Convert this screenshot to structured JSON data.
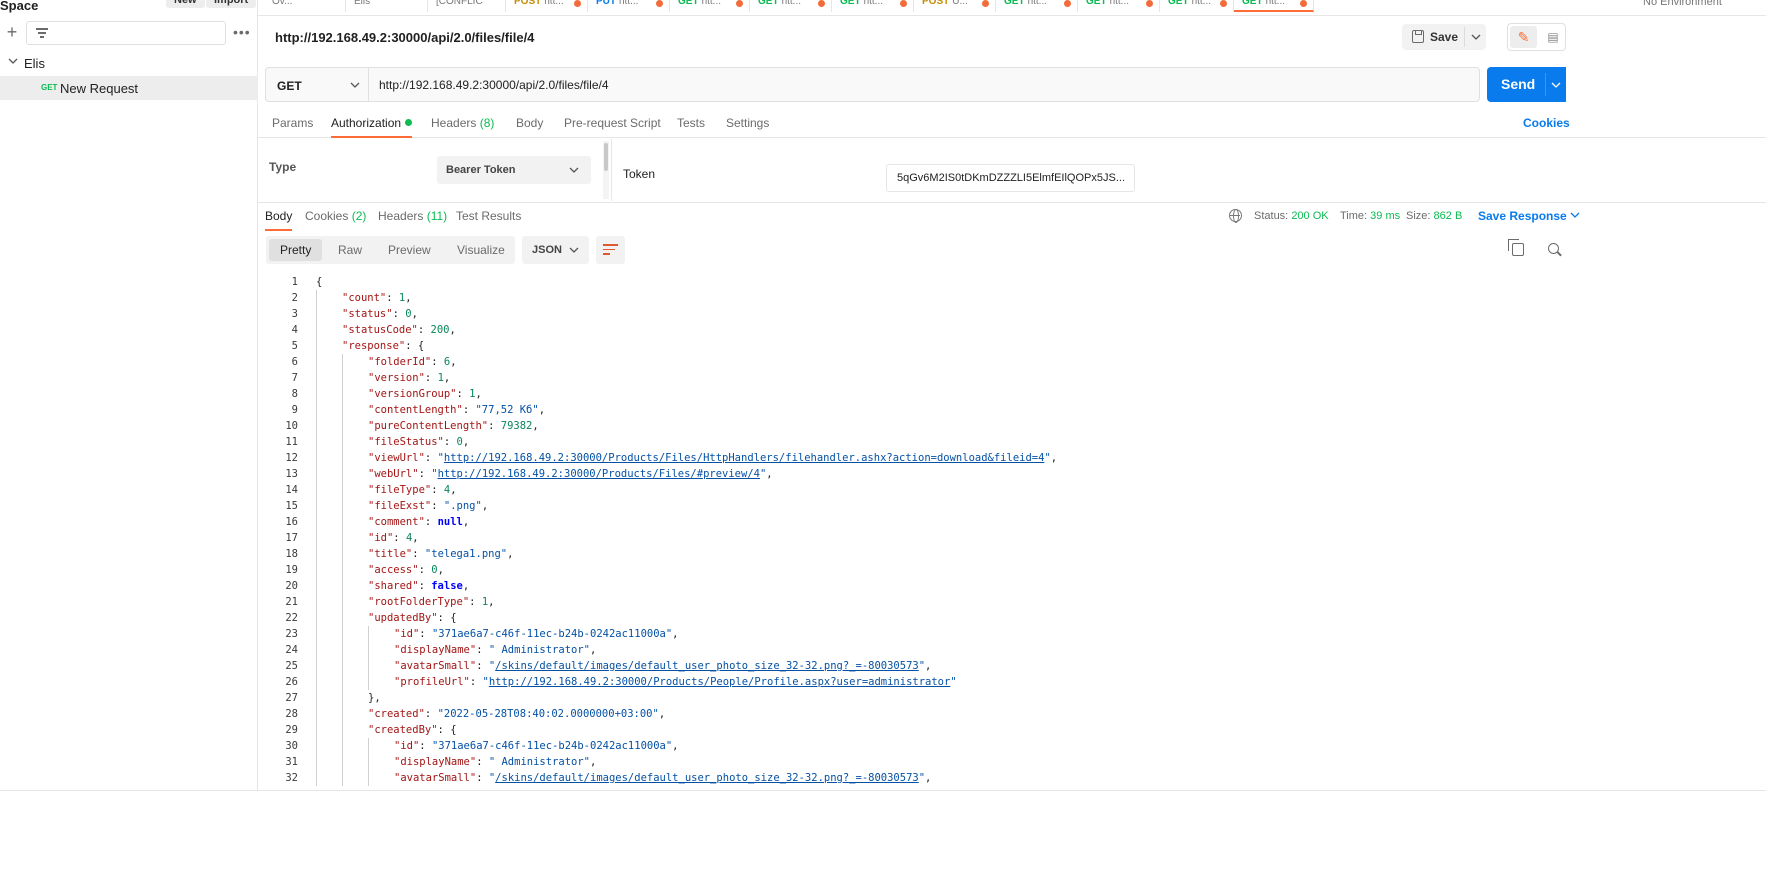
{
  "sidebar": {
    "workspace": "Space",
    "new_label": "New",
    "import_label": "Import",
    "collection": "Elis",
    "request": {
      "method": "GET",
      "name": "New Request"
    }
  },
  "tabs": [
    {
      "method": "",
      "label": "Ov..."
    },
    {
      "method": "",
      "label": "Elis"
    },
    {
      "method": "",
      "label": "[CONFLIC"
    },
    {
      "method": "POST",
      "label": "htt...",
      "color": "#c78b00"
    },
    {
      "method": "PUT",
      "label": "htt...",
      "color": "#097bed"
    },
    {
      "method": "GET",
      "label": "htt...",
      "color": "#0cbb52"
    },
    {
      "method": "GET",
      "label": "htt...",
      "color": "#0cbb52"
    },
    {
      "method": "GET",
      "label": "htt...",
      "color": "#0cbb52"
    },
    {
      "method": "POST",
      "label": "U...",
      "color": "#c78b00"
    },
    {
      "method": "GET",
      "label": "htt...",
      "color": "#0cbb52"
    },
    {
      "method": "GET",
      "label": "htt...",
      "color": "#0cbb52"
    },
    {
      "method": "GET",
      "label": "htt...",
      "color": "#0cbb52"
    },
    {
      "method": "GET",
      "label": "htt...",
      "color": "#0cbb52"
    }
  ],
  "environment": "No Environment",
  "request": {
    "title": "http://192.168.49.2:30000/api/2.0/files/file/4",
    "save_label": "Save",
    "method": "GET",
    "url": "http://192.168.49.2:30000/api/2.0/files/file/4",
    "send_label": "Send"
  },
  "request_tabs": {
    "params": "Params",
    "authorization": "Authorization",
    "headers": "Headers",
    "headers_count": "(8)",
    "body": "Body",
    "prerequest": "Pre-request Script",
    "tests": "Tests",
    "settings": "Settings",
    "cookies": "Cookies"
  },
  "auth": {
    "type_label": "Type",
    "type_value": "Bearer Token",
    "token_label": "Token",
    "token_value": "5qGv6M2IS0tDKmDZZZLI5ElmfEIlQOPx5JS..."
  },
  "response_tabs": {
    "body": "Body",
    "cookies": "Cookies",
    "cookies_count": "(2)",
    "headers": "Headers",
    "headers_count": "(11)",
    "tests": "Test Results"
  },
  "response_meta": {
    "status_label": "Status:",
    "status_value": "200 OK",
    "time_label": "Time:",
    "time_value": "39 ms",
    "size_label": "Size:",
    "size_value": "862 B",
    "save_response": "Save Response"
  },
  "view_modes": [
    "Pretty",
    "Raw",
    "Preview",
    "Visualize"
  ],
  "format": "JSON",
  "code_lines": [
    "{",
    "\"count\": 1,",
    "\"status\": 0,",
    "\"statusCode\": 200,",
    "\"response\": {",
    "\"folderId\": 6,",
    "\"version\": 1,",
    "\"versionGroup\": 1,",
    "\"contentLength\": \"77,52 Кб\",",
    "\"pureContentLength\": 79382,",
    "\"fileStatus\": 0,",
    "\"viewUrl\": \"http://192.168.49.2:30000/Products/Files/HttpHandlers/filehandler.ashx?action=download&fileid=4\",",
    "\"webUrl\": \"http://192.168.49.2:30000/Products/Files/#preview/4\",",
    "\"fileType\": 4,",
    "\"fileExst\": \".png\",",
    "\"comment\": null,",
    "\"id\": 4,",
    "\"title\": \"telega1.png\",",
    "\"access\": 0,",
    "\"shared\": false,",
    "\"rootFolderType\": 1,",
    "\"updatedBy\": {",
    "\"id\": \"371ae6a7-c46f-11ec-b24b-0242ac11000a\",",
    "\"displayName\": \" Administrator\",",
    "\"avatarSmall\": \"/skins/default/images/default_user_photo_size_32-32.png?_=-80030573\",",
    "\"profileUrl\": \"http://192.168.49.2:30000/Products/People/Profile.aspx?user=administrator\"",
    "},",
    "\"created\": \"2022-05-28T08:40:02.0000000+03:00\",",
    "\"createdBy\": {",
    "\"id\": \"371ae6a7-c46f-11ec-b24b-0242ac11000a\",",
    "\"displayName\": \" Administrator\",",
    "\"avatarSmall\": \"/skins/default/images/default_user_photo_size_32-32.png?_=-80030573\","
  ],
  "line_numbers": [
    "1",
    "2",
    "3",
    "4",
    "5",
    "6",
    "7",
    "8",
    "9",
    "10",
    "11",
    "12",
    "13",
    "14",
    "15",
    "16",
    "17",
    "18",
    "19",
    "20",
    "21",
    "22",
    "23",
    "24",
    "25",
    "26",
    "27",
    "28",
    "29",
    "30",
    "31",
    "32"
  ],
  "line_indent_levels": [
    0,
    1,
    1,
    1,
    1,
    2,
    2,
    2,
    2,
    2,
    2,
    2,
    2,
    2,
    2,
    2,
    2,
    2,
    2,
    2,
    2,
    2,
    3,
    3,
    3,
    3,
    2,
    2,
    2,
    3,
    3,
    3
  ]
}
